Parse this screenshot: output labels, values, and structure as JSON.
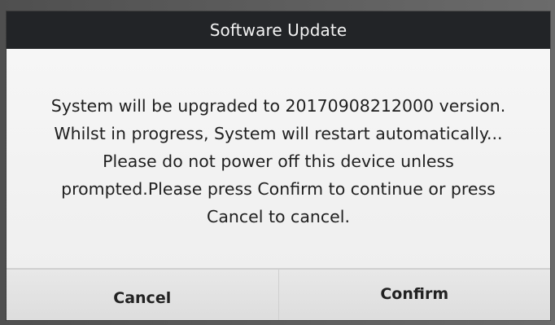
{
  "dialog": {
    "title": "Software Update",
    "message_lines": [
      "System will be upgraded to 20170908212000 version.",
      "Whilst in progress, System will restart automatically...",
      "Please do not power off this device unless",
      "prompted.Please press Confirm to continue or press",
      "Cancel to cancel."
    ],
    "buttons": {
      "cancel_label": "Cancel",
      "confirm_label": "Confirm"
    }
  },
  "colors": {
    "title_bar": "#222427",
    "dialog_background": "#f1f1f1",
    "button_background": "#e4e4e4",
    "text": "#1f1f1f"
  }
}
